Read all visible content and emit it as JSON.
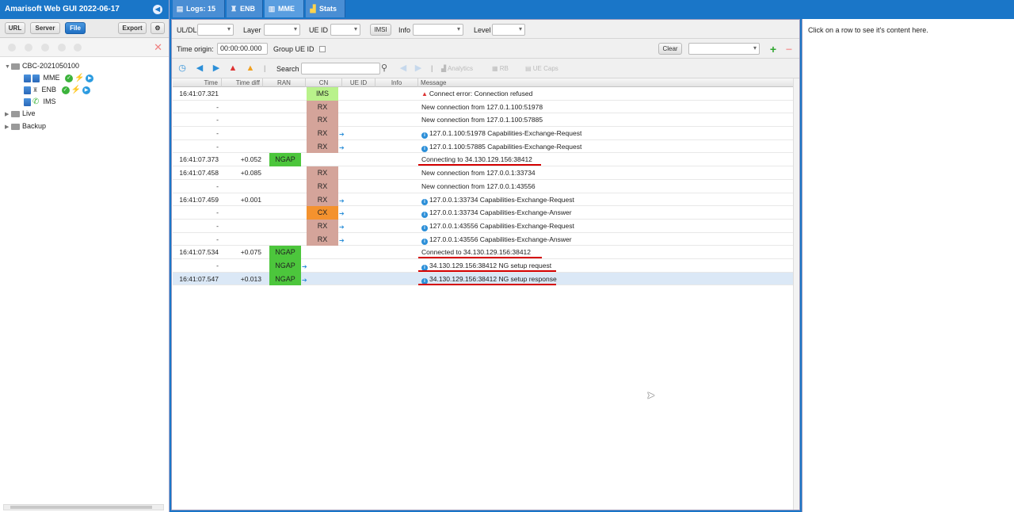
{
  "app": {
    "title": "Amarisoft Web GUI 2022-06-17"
  },
  "left_toolbar": {
    "url": "URL",
    "server": "Server",
    "file": "File",
    "export": "Export"
  },
  "tree": {
    "root": "CBC-2021050100",
    "children": [
      {
        "label": "MME"
      },
      {
        "label": "ENB"
      },
      {
        "label": "IMS"
      }
    ],
    "folders": [
      "Live",
      "Backup"
    ]
  },
  "tabs": [
    {
      "label": "Logs: 15"
    },
    {
      "label": "ENB"
    },
    {
      "label": "MME"
    },
    {
      "label": "Stats"
    }
  ],
  "filters": {
    "uldl": "UL/DL",
    "layer": "Layer",
    "ueid": "UE ID",
    "imsi": "IMSI",
    "info": "Info",
    "level": "Level"
  },
  "origin": {
    "label": "Time origin:",
    "value": "00:00:00.000",
    "group_label": "Group UE ID",
    "clear": "Clear"
  },
  "toolbar3": {
    "search_label": "Search",
    "analytics": "Analytics",
    "rb": "RB",
    "uecaps": "UE Caps"
  },
  "table": {
    "columns": [
      "Time",
      "Time diff",
      "RAN",
      "CN",
      "UE ID",
      "Info",
      "Message"
    ],
    "rows": [
      {
        "time": "16:41:07.321",
        "diff": "",
        "ran": "",
        "cn": "IMS",
        "msg": "Connect error: Connection refused"
      },
      {
        "time": "-",
        "diff": "",
        "ran": "",
        "cn": "RX",
        "msg": "New connection from 127.0.1.100:51978"
      },
      {
        "time": "-",
        "diff": "",
        "ran": "",
        "cn": "RX",
        "msg": "New connection from 127.0.1.100:57885"
      },
      {
        "time": "-",
        "diff": "",
        "ran": "",
        "cn": "RX",
        "msg": "127.0.1.100:51978 Capabilities-Exchange-Request"
      },
      {
        "time": "-",
        "diff": "",
        "ran": "",
        "cn": "RX",
        "msg": "127.0.1.100:57885 Capabilities-Exchange-Request"
      },
      {
        "time": "16:41:07.373",
        "diff": "+0.052",
        "ran": "NGAP",
        "cn": "",
        "msg": "Connecting to 34.130.129.156:38412"
      },
      {
        "time": "16:41:07.458",
        "diff": "+0.085",
        "ran": "",
        "cn": "RX",
        "msg": "New connection from 127.0.0.1:33734"
      },
      {
        "time": "-",
        "diff": "",
        "ran": "",
        "cn": "RX",
        "msg": "New connection from 127.0.0.1:43556"
      },
      {
        "time": "16:41:07.459",
        "diff": "+0.001",
        "ran": "",
        "cn": "RX",
        "msg": "127.0.0.1:33734 Capabilities-Exchange-Request"
      },
      {
        "time": "-",
        "diff": "",
        "ran": "",
        "cn": "CX",
        "msg": "127.0.0.1:33734 Capabilities-Exchange-Answer"
      },
      {
        "time": "-",
        "diff": "",
        "ran": "",
        "cn": "RX",
        "msg": "127.0.0.1:43556 Capabilities-Exchange-Request"
      },
      {
        "time": "-",
        "diff": "",
        "ran": "",
        "cn": "RX",
        "msg": "127.0.0.1:43556 Capabilities-Exchange-Answer"
      },
      {
        "time": "16:41:07.534",
        "diff": "+0.075",
        "ran": "NGAP",
        "cn": "",
        "msg": "Connected to 34.130.129.156:38412"
      },
      {
        "time": "-",
        "diff": "",
        "ran": "NGAP",
        "cn": "",
        "msg": "34.130.129.156:38412 NG setup request"
      },
      {
        "time": "16:41:07.547",
        "diff": "+0.013",
        "ran": "NGAP",
        "cn": "",
        "msg": "34.130.129.156:38412 NG setup response"
      }
    ]
  },
  "colors": {
    "IMS": "#b9f28b",
    "RX": "#d4a49a",
    "CX": "#f4922e",
    "NGAP": "#4cc63c"
  },
  "right_panel": {
    "hint": "Click on a row to see it's content here."
  }
}
